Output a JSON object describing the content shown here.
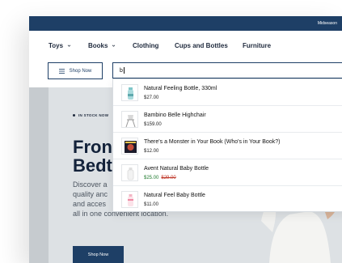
{
  "topbar": {
    "text": "Midseason"
  },
  "nav": {
    "items": [
      {
        "label": "Toys",
        "has_menu": true
      },
      {
        "label": "Books",
        "has_menu": true
      },
      {
        "label": "Clothing",
        "has_menu": false
      },
      {
        "label": "Cups and Bottles",
        "has_menu": false
      },
      {
        "label": "Furniture",
        "has_menu": false
      }
    ]
  },
  "search": {
    "shop_now_label": "Shop Now",
    "query": "b",
    "results": [
      {
        "name": "Natural Feeling Bottle, 330ml",
        "price": "$27.00",
        "thumb": "bottle-teal-icon"
      },
      {
        "name": "Bambino Belle Highchair",
        "price": "$159.00",
        "thumb": "highchair-icon"
      },
      {
        "name": "There's a Monster in Your Book (Who's in Your Book?)",
        "price": "$12.00",
        "thumb": "book-cover-icon"
      },
      {
        "name": "Avent Natural Baby Bottle",
        "price": "$25.00",
        "old_price": "$29.00",
        "thumb": "bottle-clear-icon"
      },
      {
        "name": "Natural Feel Baby Bottle",
        "price": "$11.00",
        "thumb": "bottle-pink-icon"
      }
    ]
  },
  "hero": {
    "kicker": "IN STOCK NOW",
    "title_line1": "Fron",
    "title_line2": "Bedt",
    "desc_lines": [
      "Discover a",
      "quality anc",
      "and acces",
      "all in one convenient location."
    ],
    "button_label": "Shop Now"
  },
  "colors": {
    "brand_navy": "#1e3f66",
    "sale_green": "#1f7a2e",
    "strike_red": "#c0392b"
  }
}
